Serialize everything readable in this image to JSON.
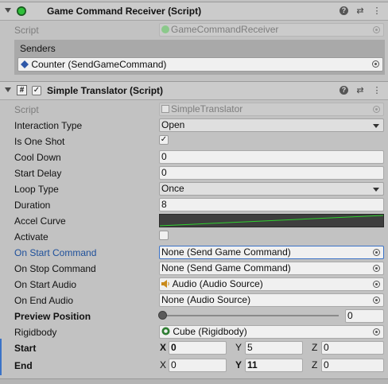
{
  "receiver": {
    "title": "Game Command Receiver (Script)",
    "script_label": "Script",
    "script_value": "GameCommandReceiver",
    "senders_label": "Senders",
    "sender_item": "Counter (SendGameCommand)"
  },
  "translator": {
    "title": "Simple Translator (Script)",
    "enabled": true,
    "script_label": "Script",
    "script_value": "SimpleTranslator",
    "fields": {
      "interaction_type": {
        "label": "Interaction Type",
        "value": "Open"
      },
      "is_one_shot": {
        "label": "Is One Shot",
        "checked": true
      },
      "cool_down": {
        "label": "Cool Down",
        "value": "0"
      },
      "start_delay": {
        "label": "Start Delay",
        "value": "0"
      },
      "loop_type": {
        "label": "Loop Type",
        "value": "Once"
      },
      "duration": {
        "label": "Duration",
        "value": "8"
      },
      "accel_curve": {
        "label": "Accel Curve"
      },
      "activate": {
        "label": "Activate",
        "checked": false
      },
      "on_start_command": {
        "label": "On Start Command",
        "value": "None (Send Game Command)"
      },
      "on_stop_command": {
        "label": "On Stop Command",
        "value": "None (Send Game Command)"
      },
      "on_start_audio": {
        "label": "On Start Audio",
        "value": "Audio (Audio Source)"
      },
      "on_end_audio": {
        "label": "On End Audio",
        "value": "None (Audio Source)"
      },
      "preview_position": {
        "label": "Preview Position",
        "value": "0",
        "fraction": 0
      },
      "rigidbody": {
        "label": "Rigidbody",
        "value": "Cube (Rigidbody)"
      },
      "start": {
        "label": "Start",
        "x": "0",
        "y": "5",
        "z": "0"
      },
      "end": {
        "label": "End",
        "x": "0",
        "y": "11",
        "z": "0"
      }
    }
  },
  "axis": {
    "x": "X",
    "y": "Y",
    "z": "Z"
  },
  "colors": {
    "accent": "#3a72c7",
    "curve": "#2fd12f",
    "curve_bg": "#3e3e3e"
  }
}
